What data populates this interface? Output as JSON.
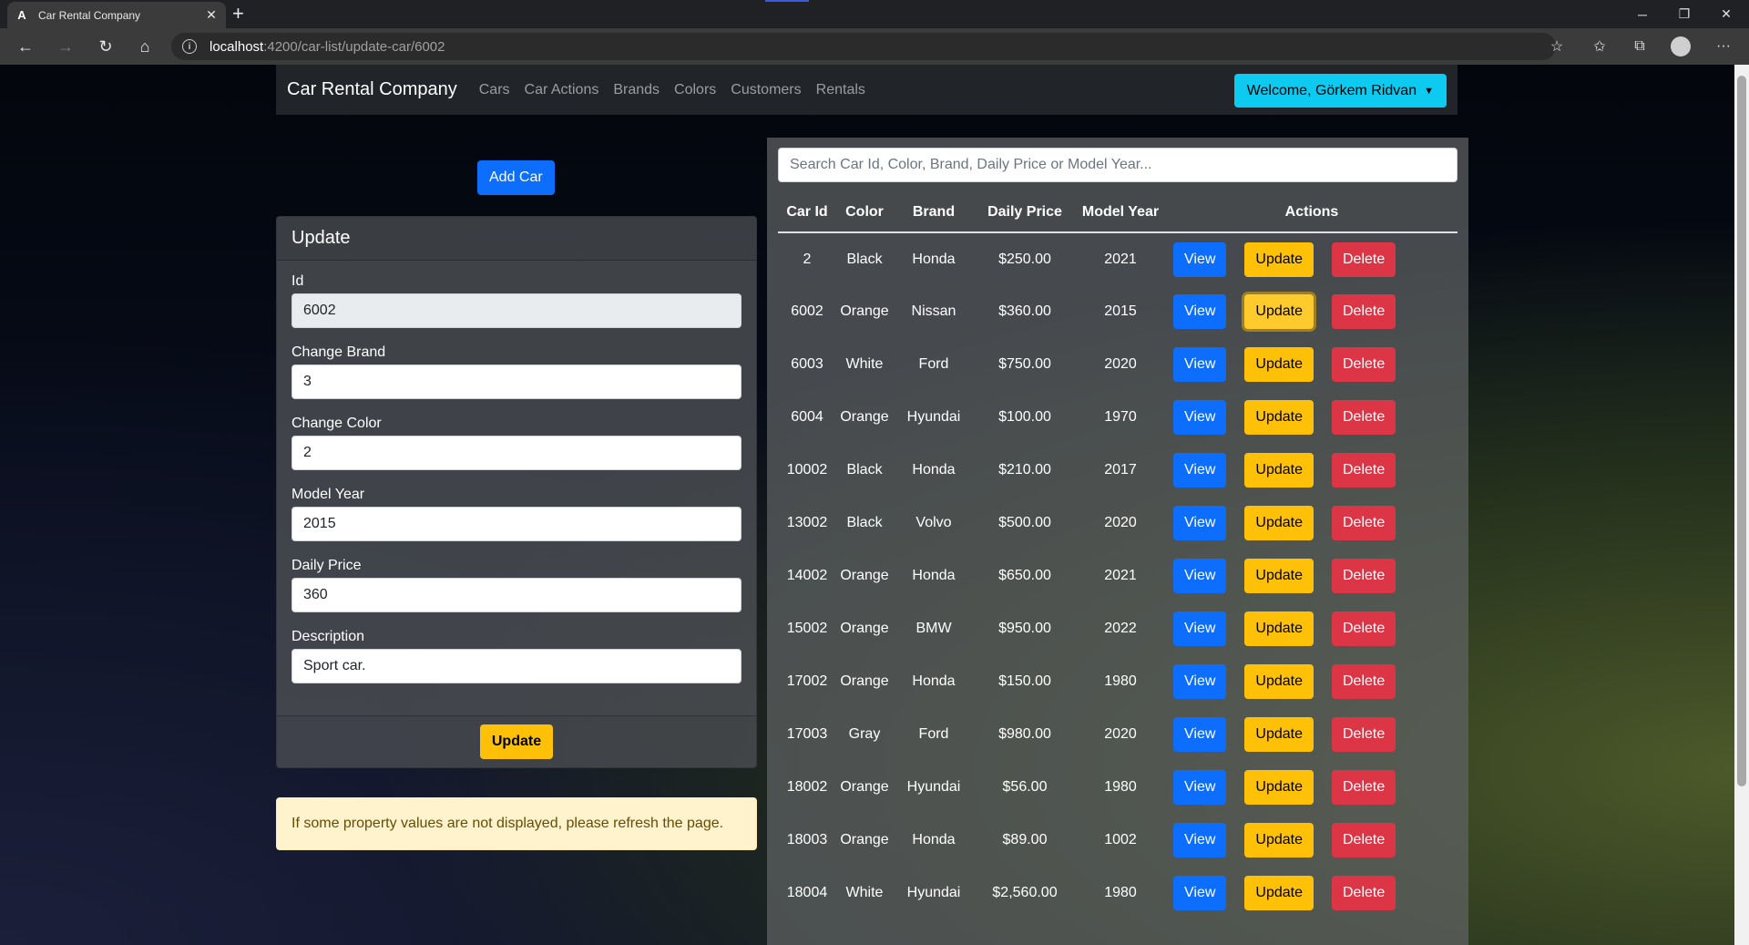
{
  "browser": {
    "tab_title": "Car Rental Company",
    "favicon": "A",
    "tab_close": "✕",
    "new_tab": "+",
    "url_host": "localhost",
    "url_path": ":4200/car-list/update-car/6002",
    "window_controls": {
      "minimize": "─",
      "restore": "❐",
      "close": "✕"
    },
    "tools": {
      "favorite": "☆",
      "favorites_list": "✩",
      "collections": "⧉",
      "more": "···"
    },
    "nav": {
      "back": "←",
      "forward": "→",
      "reload": "↻",
      "home": "⌂"
    }
  },
  "navbar": {
    "brand": "Car Rental Company",
    "links": [
      "Cars",
      "Car Actions",
      "Brands",
      "Colors",
      "Customers",
      "Rentals"
    ],
    "welcome": "Welcome, Görkem Ridvan",
    "caret": "▼"
  },
  "add_car_label": "Add Car",
  "update_form": {
    "title": "Update",
    "fields": [
      {
        "label": "Id",
        "value": "6002",
        "disabled": true
      },
      {
        "label": "Change Brand",
        "value": "3"
      },
      {
        "label": "Change Color",
        "value": "2"
      },
      {
        "label": "Model Year",
        "value": "2015"
      },
      {
        "label": "Daily Price",
        "value": "360"
      },
      {
        "label": "Description",
        "value": "Sport car."
      }
    ],
    "submit_label": "Update"
  },
  "alert_text": "If some property values are not displayed, please refresh the page.",
  "search": {
    "placeholder": "Search Car Id, Color, Brand, Daily Price or Model Year..."
  },
  "table": {
    "headers": [
      "Car Id",
      "Color",
      "Brand",
      "Daily Price",
      "Model Year",
      "Actions"
    ],
    "action_labels": {
      "view": "View",
      "update": "Update",
      "delete": "Delete"
    },
    "rows": [
      [
        "2",
        "Black",
        "Honda",
        "$250.00",
        "2021"
      ],
      [
        "6002",
        "Orange",
        "Nissan",
        "$360.00",
        "2015"
      ],
      [
        "6003",
        "White",
        "Ford",
        "$750.00",
        "2020"
      ],
      [
        "6004",
        "Orange",
        "Hyundai",
        "$100.00",
        "1970"
      ],
      [
        "10002",
        "Black",
        "Honda",
        "$210.00",
        "2017"
      ],
      [
        "13002",
        "Black",
        "Volvo",
        "$500.00",
        "2020"
      ],
      [
        "14002",
        "Orange",
        "Honda",
        "$650.00",
        "2021"
      ],
      [
        "15002",
        "Orange",
        "BMW",
        "$950.00",
        "2022"
      ],
      [
        "17002",
        "Orange",
        "Honda",
        "$150.00",
        "1980"
      ],
      [
        "17003",
        "Gray",
        "Ford",
        "$980.00",
        "2020"
      ],
      [
        "18002",
        "Orange",
        "Hyundai",
        "$56.00",
        "1980"
      ],
      [
        "18003",
        "Orange",
        "Honda",
        "$89.00",
        "1002"
      ],
      [
        "18004",
        "White",
        "Hyundai",
        "$2,560.00",
        "1980"
      ]
    ]
  }
}
